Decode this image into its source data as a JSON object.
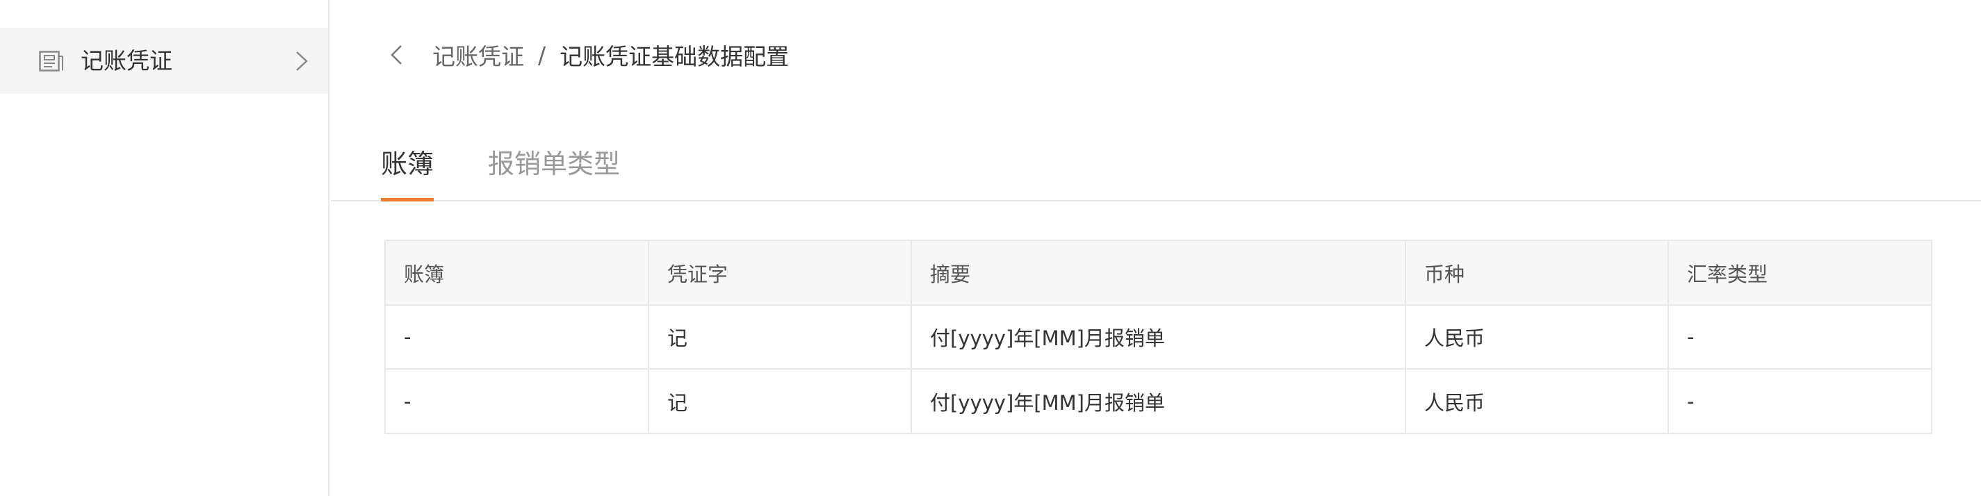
{
  "sidebar": {
    "items": [
      {
        "label": "记账凭证",
        "icon": "document-icon",
        "chevron": "chevron-right-icon"
      }
    ]
  },
  "breadcrumb": {
    "back_icon": "chevron-left-icon",
    "parent": "记账凭证",
    "separator": "/",
    "current": "记账凭证基础数据配置"
  },
  "tabs": [
    {
      "label": "账簿",
      "active": true
    },
    {
      "label": "报销单类型",
      "active": false
    }
  ],
  "table": {
    "columns": [
      "账簿",
      "凭证字",
      "摘要",
      "币种",
      "汇率类型"
    ],
    "rows": [
      [
        "-",
        "记",
        "付[yyyy]年[MM]月报销单",
        "人民币",
        "-"
      ],
      [
        "-",
        "记",
        "付[yyyy]年[MM]月报销单",
        "人民币",
        "-"
      ]
    ]
  },
  "colors": {
    "accent": "#f07c30",
    "sidebar_active_bg": "#f5f5f5",
    "border": "#e8e8e8",
    "header_bg": "#f7f7f7"
  }
}
